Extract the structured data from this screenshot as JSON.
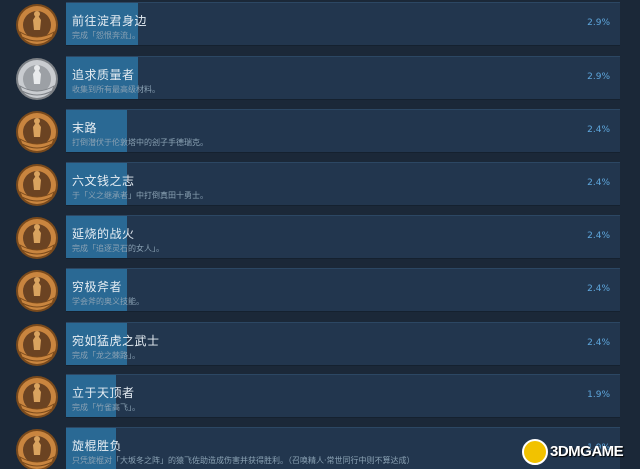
{
  "achievements": [
    {
      "title": "前往淀君身边",
      "desc": "完成「怨恨奔流」。",
      "percent": "2.9%",
      "fill": 0.13,
      "tier": "bronze",
      "icon": "figure-kneel-icon"
    },
    {
      "title": "追求质量者",
      "desc": "收集到所有最高级材料。",
      "percent": "2.9%",
      "fill": 0.13,
      "tier": "silver",
      "icon": "swirl-icon"
    },
    {
      "title": "末路",
      "desc": "打倒潜伏于伦敦塔中的刽子手德瑞克。",
      "percent": "2.4%",
      "fill": 0.11,
      "tier": "bronze",
      "icon": "executioner-icon"
    },
    {
      "title": "六文钱之志",
      "desc": "于「义之继承者」中打倒真田十勇士。",
      "percent": "2.4%",
      "fill": 0.11,
      "tier": "bronze",
      "icon": "warrior-icon"
    },
    {
      "title": "延烧的战火",
      "desc": "完成「追逐灵石的女人」。",
      "percent": "2.4%",
      "fill": 0.11,
      "tier": "bronze",
      "icon": "woman-icon"
    },
    {
      "title": "穷极斧者",
      "desc": "学会斧的奥义技能。",
      "percent": "2.4%",
      "fill": 0.11,
      "tier": "bronze",
      "icon": "axe-icon"
    },
    {
      "title": "宛如猛虎之武士",
      "desc": "完成「龙之棘路」。",
      "percent": "2.4%",
      "fill": 0.11,
      "tier": "bronze",
      "icon": "tiger-samurai-icon"
    },
    {
      "title": "立于天顶者",
      "desc": "完成「竹雀高飞」。",
      "percent": "1.9%",
      "fill": 0.09,
      "tier": "bronze",
      "icon": "bird-icon"
    },
    {
      "title": "旋棍胜负",
      "desc": "只凭旋棍对「大坂冬之阵」的猿飞佐助造成伤害并获得胜利。（召唤精人·常世同行中则不算达成）",
      "percent": "1.9%",
      "fill": 0.09,
      "tier": "bronze",
      "icon": "tonfa-icon"
    }
  ],
  "watermark": {
    "text": "3DMGAME"
  }
}
